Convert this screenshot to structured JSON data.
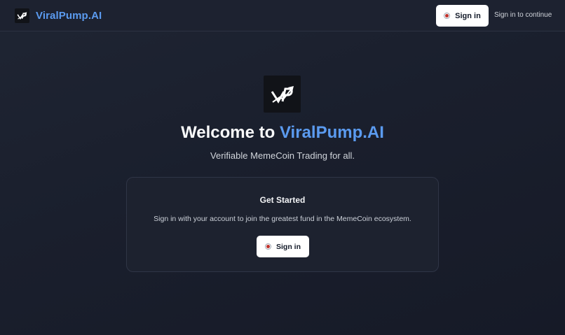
{
  "header": {
    "brand_name": "ViralPump.AI",
    "sign_in_label": "Sign in",
    "hint": "Sign in to continue"
  },
  "hero": {
    "title_prefix": "Welcome to ",
    "title_accent": "ViralPump.AI",
    "subtitle": "Verifiable MemeCoin Trading for all."
  },
  "card": {
    "title": "Get Started",
    "description": "Sign in with your account to join the greatest fund in the MemeCoin ecosystem.",
    "sign_in_label": "Sign in"
  },
  "colors": {
    "accent": "#5b9bf0",
    "background": "#1b2030",
    "button_bg": "#ffffff",
    "sign_in_dot": "#c0322b"
  },
  "icons": {
    "logo": "vp-logo-icon",
    "sign_in": "record-dot-icon"
  }
}
